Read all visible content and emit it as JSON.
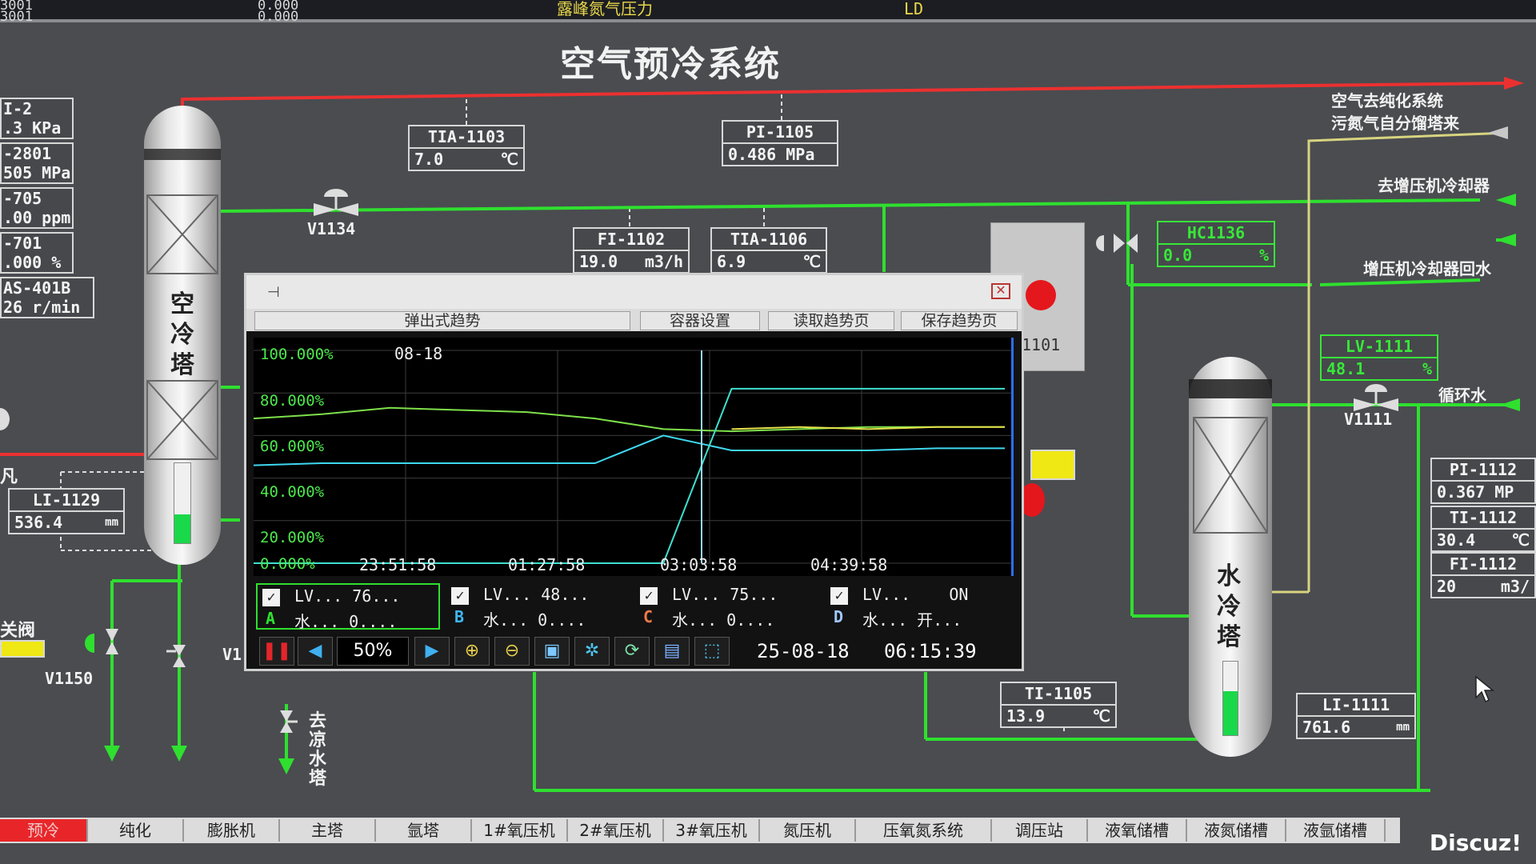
{
  "top_strip": {
    "line1": "3001",
    "line2": "3001",
    "val1": "0.000",
    "val2": "0.000",
    "caption": "露峰氮气压力",
    "unit": "LD"
  },
  "title": "空气预冷系统",
  "left_tags": [
    {
      "name": "I-2",
      "value": ".3 KPa"
    },
    {
      "name": "-2801",
      "value": "505 MPa"
    },
    {
      "name": "-705",
      "value": ".00 ppm"
    },
    {
      "name": "-701",
      "value": ".000 %"
    },
    {
      "name": "AS-401B",
      "value": "26 r/min"
    }
  ],
  "tags": {
    "tia1103": {
      "name": "TIA-1103",
      "value": "7.0",
      "unit": "℃"
    },
    "pi1105": {
      "name": "PI-1105",
      "value": "0.486 MPa",
      "unit": ""
    },
    "fi1102": {
      "name": "FI-1102",
      "value": "19.0",
      "unit": "m3/h"
    },
    "tia1106": {
      "name": "TIA-1106",
      "value": "6.9",
      "unit": "℃"
    },
    "hc1136": {
      "name": "HC1136",
      "value": "0.0",
      "unit": "%"
    },
    "lv1111": {
      "name": "LV-1111",
      "value": "48.1",
      "unit": "%"
    },
    "li1129": {
      "name": "LI-1129",
      "value": "536.4",
      "unit": "mm"
    },
    "ti1105": {
      "name": "TI-1105",
      "value": "13.9",
      "unit": "℃"
    },
    "li1111": {
      "name": "LI-1111",
      "value": "761.6",
      "unit": "mm"
    }
  },
  "right_tags": [
    {
      "name": "PI-1112",
      "value": "0.367 MP"
    },
    {
      "name": "TI-1112",
      "value": "30.4",
      "unit": "℃"
    },
    {
      "name": "FI-1112",
      "value": "20",
      "unit": "m3/"
    }
  ],
  "labels": {
    "to_purify": "空气去纯化系统",
    "waste_n2": "污氮气自分馏塔来",
    "to_booster_cooler": "去增压机冷却器",
    "booster_cooler_return": "增压机冷却器回水",
    "circ_water": "循环水",
    "v1134": "V1134",
    "v1111": "V1111",
    "v1150": "V1150",
    "v_partial": "V1",
    "close_valve": "关阀",
    "to_cooling_tower": "去凉水塔",
    "air_tower": "空冷塔",
    "water_tower": "水冷塔",
    "unit_1101": "1101",
    "left_fragment": "凡"
  },
  "popup": {
    "tab_trend": "弹出式趋势",
    "tab_container": "容器设置",
    "tab_read": "读取趋势页",
    "tab_save": "保存趋势页",
    "date_label": "08-18",
    "zoom": "50%",
    "date": "25-08-18",
    "time": "06:15:39",
    "legend": [
      {
        "letter": "A",
        "line1_name": "LV...",
        "line1_val": "76...",
        "line2_name": "水...",
        "line2_val": "0....",
        "letter_color": "#2fe02f"
      },
      {
        "letter": "B",
        "line1_name": "LV...",
        "line1_val": "48...",
        "line2_name": "水...",
        "line2_val": "0....",
        "letter_color": "#3fb8f0"
      },
      {
        "letter": "C",
        "line1_name": "LV...",
        "line1_val": "75...",
        "line2_name": "水...",
        "line2_val": "0....",
        "letter_color": "#f07a4a"
      },
      {
        "letter": "D",
        "line1_name": "LV...",
        "line1_val": "ON",
        "line2_name": "水...",
        "line2_val": "开...",
        "letter_color": "#a0c8ff"
      }
    ]
  },
  "chart_data": {
    "type": "line",
    "ylim": [
      0,
      100
    ],
    "yticks": [
      "100.000%",
      "80.000%",
      "60.000%",
      "40.000%",
      "20.000%",
      "0.000%"
    ],
    "xticks": [
      "23:51:58",
      "01:27:58",
      "03:03:58",
      "04:39:58"
    ],
    "series": [
      {
        "color": "#7ee04a",
        "values": [
          68,
          70,
          73,
          72,
          71,
          68,
          63,
          62,
          63,
          64,
          64,
          64
        ]
      },
      {
        "color": "#e6e04a",
        "values": [
          null,
          null,
          null,
          null,
          null,
          null,
          null,
          63,
          64,
          63,
          64,
          64
        ]
      },
      {
        "color": "#3fd8f0",
        "values": [
          46,
          47,
          47,
          47,
          47,
          47,
          60,
          53,
          53,
          53,
          54,
          54
        ]
      },
      {
        "color": "#3fe0d0",
        "values": [
          0,
          0,
          0,
          0,
          0,
          0,
          0,
          82,
          82,
          82,
          82,
          82
        ]
      }
    ]
  },
  "nav": [
    "预冷",
    "纯化",
    "膨胀机",
    "主塔",
    "氩塔",
    "1#氧压机",
    "2#氧压机",
    "3#氧压机",
    "氮压机",
    "压氧氮系统",
    "调压站",
    "液氧储槽",
    "液氮储槽",
    "液氩储槽"
  ],
  "watermark": "Discuz!"
}
